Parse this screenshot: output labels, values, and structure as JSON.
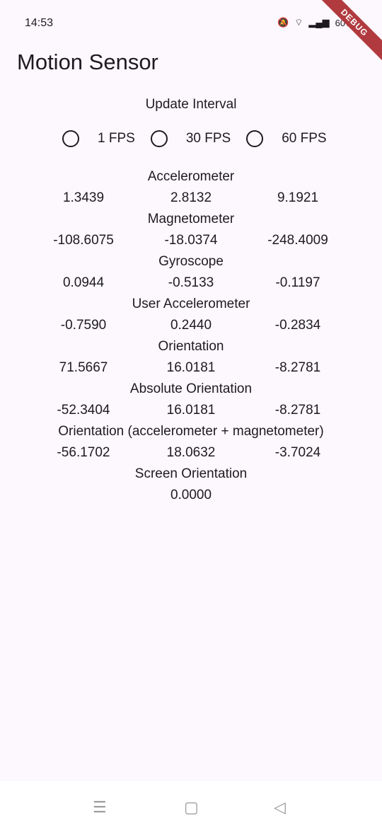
{
  "status": {
    "time": "14:53",
    "battery": "60%"
  },
  "debug_banner": "DEBUG",
  "app_title": "Motion Sensor",
  "update_interval": {
    "label": "Update Interval",
    "options": [
      "1 FPS",
      "30 FPS",
      "60 FPS"
    ]
  },
  "sensors": [
    {
      "name": "Accelerometer",
      "values": [
        "1.3439",
        "2.8132",
        "9.1921"
      ]
    },
    {
      "name": "Magnetometer",
      "values": [
        "-108.6075",
        "-18.0374",
        "-248.4009"
      ]
    },
    {
      "name": "Gyroscope",
      "values": [
        "0.0944",
        "-0.5133",
        "-0.1197"
      ]
    },
    {
      "name": "User Accelerometer",
      "values": [
        "-0.7590",
        "0.2440",
        "-0.2834"
      ]
    },
    {
      "name": "Orientation",
      "values": [
        "71.5667",
        "16.0181",
        "-8.2781"
      ]
    },
    {
      "name": "Absolute Orientation",
      "values": [
        "-52.3404",
        "16.0181",
        "-8.2781"
      ]
    },
    {
      "name": "Orientation (accelerometer + magnetometer)",
      "values": [
        "-56.1702",
        "18.0632",
        "-3.7024"
      ]
    }
  ],
  "screen_orientation": {
    "name": "Screen Orientation",
    "value": "0.0000"
  }
}
